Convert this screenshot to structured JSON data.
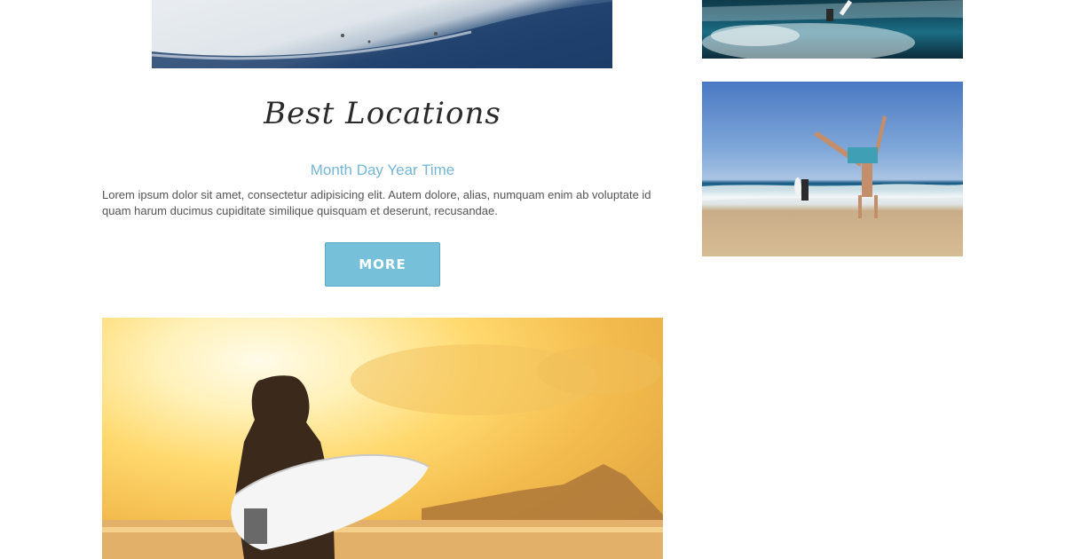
{
  "article": {
    "title": "Best Locations",
    "date": "Month Day Year Time",
    "body": "Lorem ipsum dolor sit amet, consectetur adipisicing elit. Autem dolore, alias, numquam enim ab voluptate id quam harum ducimus cupiditate similique quisquam et deserunt, recusandae.",
    "more_label": "MORE"
  },
  "colors": {
    "accent": "#77c0d9",
    "date_text": "#74b7d4"
  }
}
